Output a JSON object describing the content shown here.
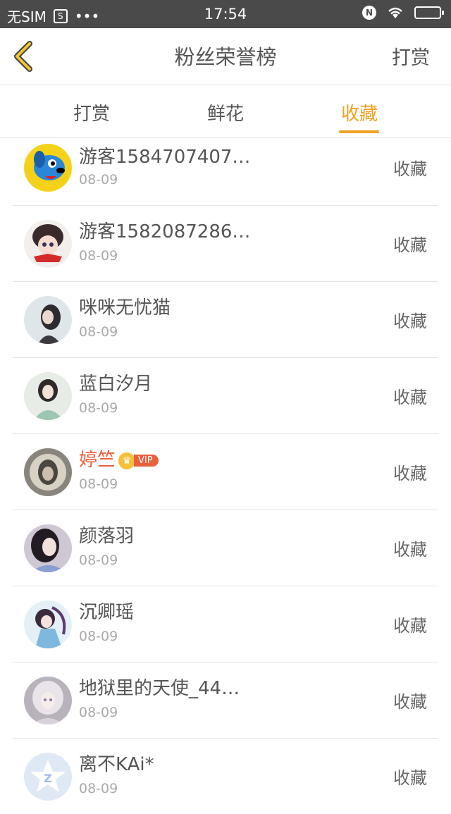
{
  "status_bar": {
    "carrier": "无SIM",
    "sim_icon": "S",
    "dots": "•••",
    "time": "17:54",
    "nfc": "N"
  },
  "header": {
    "title": "粉丝荣誉榜",
    "action": "打赏"
  },
  "tabs": [
    {
      "label": "打赏",
      "active": false
    },
    {
      "label": "鲜花",
      "active": false
    },
    {
      "label": "收藏",
      "active": true
    }
  ],
  "colors": {
    "accent": "#f0a020",
    "vip_name": "#e8603c"
  },
  "items": [
    {
      "name": "游客1584707407…",
      "date": "08-09",
      "action": "收藏",
      "avatar": "cartoon-dog-avatar"
    },
    {
      "name": "游客1582087286…",
      "date": "08-09",
      "action": "收藏",
      "avatar": "anime-character-avatar"
    },
    {
      "name": "咪咪无忧猫",
      "date": "08-09",
      "action": "收藏",
      "avatar": "photo-avatar"
    },
    {
      "name": "蓝白汐月",
      "date": "08-09",
      "action": "收藏",
      "avatar": "photo-avatar"
    },
    {
      "name": "婷竺",
      "date": "08-09",
      "action": "收藏",
      "avatar": "photo-avatar",
      "vip": true,
      "vip_label": "VIP"
    },
    {
      "name": "颜落羽",
      "date": "08-09",
      "action": "收藏",
      "avatar": "photo-avatar"
    },
    {
      "name": "沉卿瑶",
      "date": "08-09",
      "action": "收藏",
      "avatar": "photo-avatar"
    },
    {
      "name": "地狱里的天使_44…",
      "date": "08-09",
      "action": "收藏",
      "avatar": "anime-avatar"
    },
    {
      "name": "离不KAi*",
      "date": "08-09",
      "action": "收藏",
      "avatar": "default-qq-avatar"
    }
  ]
}
